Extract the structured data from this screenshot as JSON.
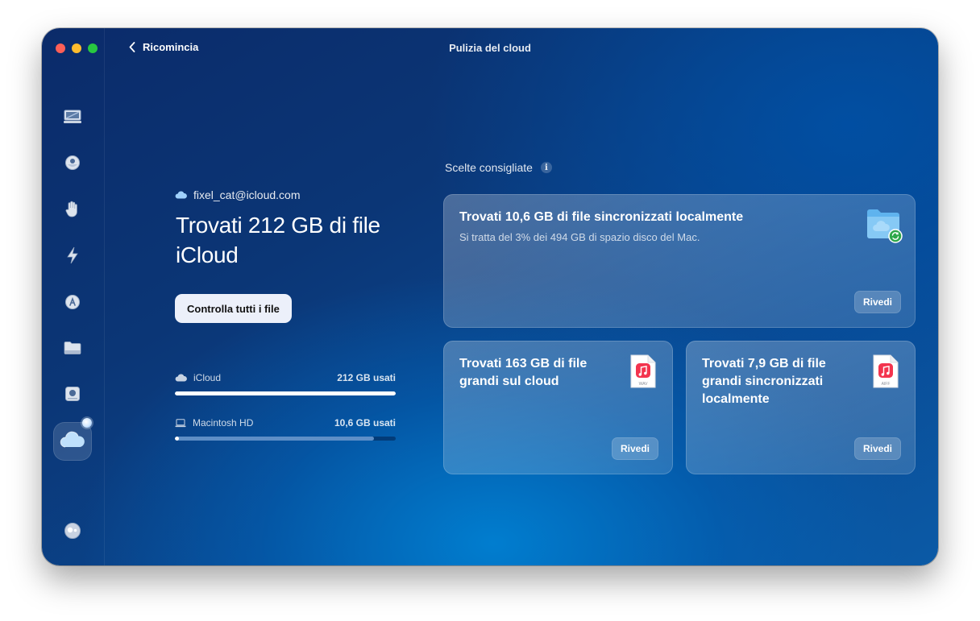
{
  "window": {
    "title": "Pulizia del cloud"
  },
  "nav": {
    "back_label": "Ricomincia"
  },
  "sidebar": {
    "items": [
      {
        "icon": "computer-icon"
      },
      {
        "icon": "mouse-icon"
      },
      {
        "icon": "hand-icon"
      },
      {
        "icon": "lightning-icon"
      },
      {
        "icon": "app-store-icon"
      },
      {
        "icon": "folder-icon"
      },
      {
        "icon": "disk-icon"
      },
      {
        "icon": "cloud-icon",
        "active": true
      },
      {
        "icon": "assistant-icon"
      }
    ]
  },
  "summary": {
    "account": "fixel_cat@icloud.com",
    "headline": "Trovati 212 GB di file iCloud",
    "check_all_label": "Controlla tutti i file"
  },
  "storage": [
    {
      "name": "iCloud",
      "used": "212 GB usati",
      "fill_fraction": 1.0,
      "rest_fraction": 0.0
    },
    {
      "name": "Macintosh HD",
      "used": "10,6 GB usati",
      "fill_fraction": 0.02,
      "rest_fraction": 0.88
    }
  ],
  "recommendations": {
    "heading": "Scelte consigliate",
    "info_icon": "info-icon",
    "cards": [
      {
        "title": "Trovati 10,6 GB di file sincronizzati localmente",
        "subtitle": "Si tratta del 3% dei 494 GB di spazio disco del Mac.",
        "review_label": "Rivedi",
        "icon": "synced-folder-icon"
      },
      {
        "title": "Trovati 163 GB di file grandi sul cloud",
        "review_label": "Rivedi",
        "icon": "wav-file-icon",
        "file_ext": "WAV"
      },
      {
        "title": "Trovati 7,9 GB di file grandi sincronizzati localmente",
        "review_label": "Rivedi",
        "icon": "aiff-file-icon",
        "file_ext": "AIFF"
      }
    ]
  },
  "colors": {
    "accent_bar": "#ffffff",
    "disk_bar_rest": "#6f9fd6",
    "button_light": "#ecf0fa",
    "music_red": "#f3344e"
  }
}
